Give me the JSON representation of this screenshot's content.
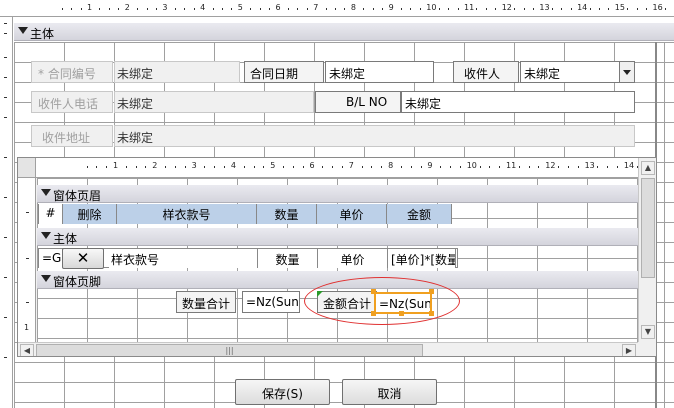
{
  "outer_ruler": {
    "ticks": [
      "1",
      "2",
      "3",
      "4",
      "5",
      "6",
      "7",
      "8",
      "9",
      "10",
      "11",
      "12",
      "13",
      "14",
      "15",
      "16",
      "17"
    ]
  },
  "detail_section": {
    "label": "主体"
  },
  "fields": {
    "contract_no_label": "* 合同编号",
    "contract_no_value": "未绑定",
    "contract_date_label": "合同日期",
    "contract_date_value": "未绑定",
    "consignee_label": "收件人",
    "consignee_value": "未绑定",
    "consignee_phone_label": "收件人电话",
    "consignee_phone_value": "未绑定",
    "bl_no_label": "B/L NO",
    "bl_no_value": "未绑定",
    "consignee_address_label": "收件地址",
    "consignee_address_value": "未绑定"
  },
  "subform": {
    "ruler_ticks": [
      "1",
      "2",
      "3",
      "4",
      "5",
      "6",
      "7",
      "8",
      "9",
      "10",
      "11",
      "12",
      "13",
      "14",
      "15"
    ],
    "form_header_label": "窗体页眉",
    "columns": [
      "#",
      "删除",
      "样衣款号",
      "数量",
      "单价",
      "金额"
    ],
    "detail_label": "主体",
    "detail_row": {
      "hash": "=Ge",
      "style_no": "样衣款号",
      "quantity": "数量",
      "unit_price": "单价",
      "amount": "[单价]*[数量"
    },
    "form_footer_label": "窗体页脚",
    "footer": {
      "qty_total_label": "数量合计",
      "qty_total_value": "=Nz(Sun",
      "amount_total_label": "金额合计",
      "amount_total_value": "=Nz(Sun"
    },
    "highlight_color": "#e03030",
    "selection_color": "#f0a020"
  },
  "buttons": {
    "save": "保存(S)",
    "cancel": "取消"
  }
}
